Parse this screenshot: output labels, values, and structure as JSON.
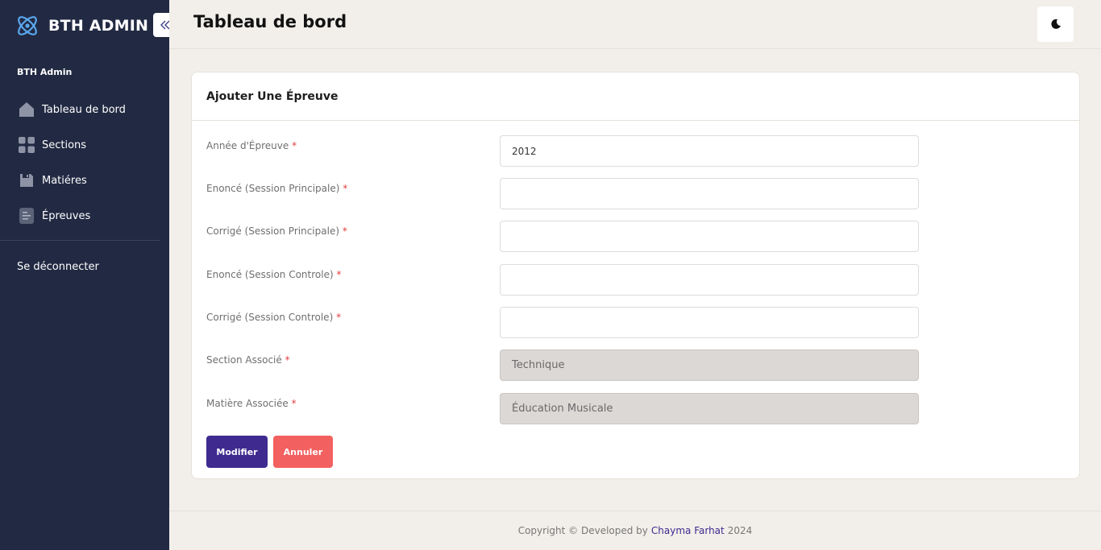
{
  "app": {
    "brand": "BTH ADMIN",
    "icons": {
      "logo": "atom-logo-icon",
      "collapse": "chevron-double-left-icon",
      "theme": "moon-icon"
    }
  },
  "sidebar": {
    "section_header": "BTH Admin",
    "items": [
      {
        "label": "Tableau de bord",
        "icon": "home-icon"
      },
      {
        "label": "Sections",
        "icon": "grid-icon"
      },
      {
        "label": "Matiéres",
        "icon": "floppy-disk-icon"
      },
      {
        "label": "Épreuves",
        "icon": "document-list-icon"
      }
    ],
    "logout_label": "Se déconnecter"
  },
  "header": {
    "title": "Tableau de bord"
  },
  "card": {
    "title": "Ajouter Une Épreuve"
  },
  "form": {
    "required_marker": "*",
    "fields": [
      {
        "label": "Année d'Épreuve",
        "value": "2012",
        "type": "input"
      },
      {
        "label": "Enoncé (Session Principale)",
        "value": "",
        "type": "input"
      },
      {
        "label": "Corrigé (Session Principale)",
        "value": "",
        "type": "input"
      },
      {
        "label": "Enoncé (Session Controle)",
        "value": "",
        "type": "input"
      },
      {
        "label": "Corrigé (Session Controle)",
        "value": "",
        "type": "input"
      },
      {
        "label": "Section Associé",
        "value": "Technique",
        "type": "select"
      },
      {
        "label": "Matière Associée",
        "value": "Éducation Musicale",
        "type": "select"
      }
    ],
    "submit_label": "Modifier",
    "cancel_label": "Annuler"
  },
  "footer": {
    "prefix": "Copyright © Developed by",
    "author": "Chayma Farhat",
    "year": "2024"
  },
  "colors": {
    "sidebar_bg": "#222a43",
    "primary": "#3f2a8f",
    "danger": "#f36060",
    "page_bg": "#f2efea"
  }
}
